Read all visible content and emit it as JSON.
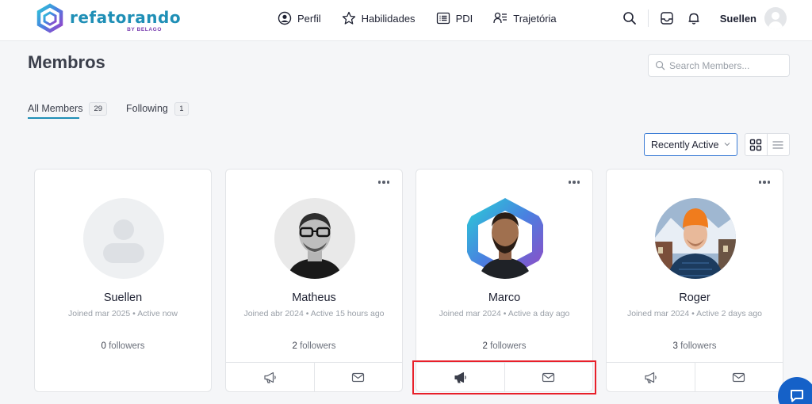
{
  "brand": {
    "name": "refatorando",
    "sub": "BY BELAGO"
  },
  "nav": [
    {
      "label": "Perfil",
      "icon": "user-circle-icon"
    },
    {
      "label": "Habilidades",
      "icon": "star-icon"
    },
    {
      "label": "PDI",
      "icon": "list-box-icon"
    },
    {
      "label": "Trajetória",
      "icon": "user-list-icon"
    }
  ],
  "header": {
    "user_name": "Suellen"
  },
  "page": {
    "title": "Membros"
  },
  "search": {
    "placeholder": "Search Members..."
  },
  "tabs": [
    {
      "label": "All Members",
      "count": "29",
      "active": true
    },
    {
      "label": "Following",
      "count": "1",
      "active": false
    }
  ],
  "sort": {
    "selected": "Recently Active"
  },
  "members": [
    {
      "name": "Suellen",
      "joined": "Joined mar 2025",
      "active": "Active now",
      "followers_count": "0",
      "followers_label": "followers"
    },
    {
      "name": "Matheus",
      "joined": "Joined abr 2024",
      "active": "Active 15 hours ago",
      "followers_count": "2",
      "followers_label": "followers"
    },
    {
      "name": "Marco",
      "joined": "Joined mar 2024",
      "active": "Active a day ago",
      "followers_count": "2",
      "followers_label": "followers"
    },
    {
      "name": "Roger",
      "joined": "Joined mar 2024",
      "active": "Active 2 days ago",
      "followers_count": "3",
      "followers_label": "followers"
    }
  ],
  "colors": {
    "accent": "#1f8fb6",
    "highlight": "#e8202a",
    "chat": "#1561c8",
    "select_border": "#3a7bd5"
  }
}
